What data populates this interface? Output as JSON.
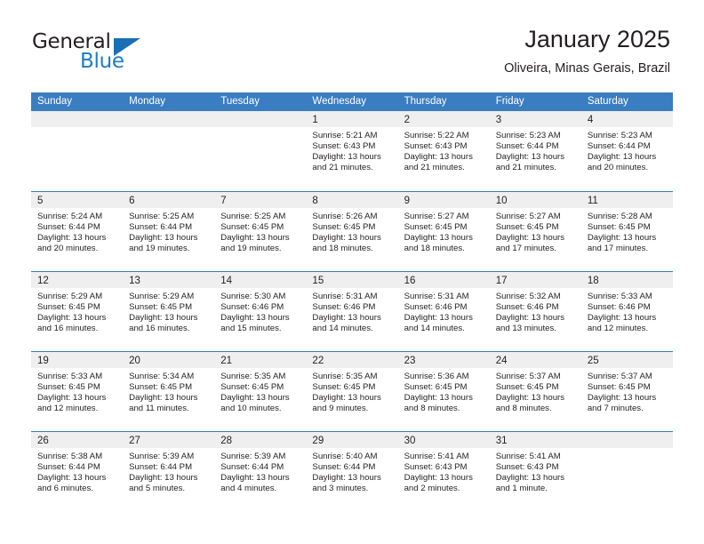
{
  "brand": {
    "name_top": "General",
    "name_bottom": "Blue",
    "accent_color": "#1a6fb5"
  },
  "header": {
    "title": "January 2025",
    "subtitle": "Oliveira, Minas Gerais, Brazil"
  },
  "calendar": {
    "header_bg": "#3a7dc0",
    "daynum_bg": "#efefef",
    "weekday_names": [
      "Sunday",
      "Monday",
      "Tuesday",
      "Wednesday",
      "Thursday",
      "Friday",
      "Saturday"
    ],
    "weeks": [
      [
        {
          "day": "",
          "lines": []
        },
        {
          "day": "",
          "lines": []
        },
        {
          "day": "",
          "lines": []
        },
        {
          "day": "1",
          "lines": [
            "Sunrise: 5:21 AM",
            "Sunset: 6:43 PM",
            "Daylight: 13 hours",
            "and 21 minutes."
          ]
        },
        {
          "day": "2",
          "lines": [
            "Sunrise: 5:22 AM",
            "Sunset: 6:43 PM",
            "Daylight: 13 hours",
            "and 21 minutes."
          ]
        },
        {
          "day": "3",
          "lines": [
            "Sunrise: 5:23 AM",
            "Sunset: 6:44 PM",
            "Daylight: 13 hours",
            "and 21 minutes."
          ]
        },
        {
          "day": "4",
          "lines": [
            "Sunrise: 5:23 AM",
            "Sunset: 6:44 PM",
            "Daylight: 13 hours",
            "and 20 minutes."
          ]
        }
      ],
      [
        {
          "day": "5",
          "lines": [
            "Sunrise: 5:24 AM",
            "Sunset: 6:44 PM",
            "Daylight: 13 hours",
            "and 20 minutes."
          ]
        },
        {
          "day": "6",
          "lines": [
            "Sunrise: 5:25 AM",
            "Sunset: 6:44 PM",
            "Daylight: 13 hours",
            "and 19 minutes."
          ]
        },
        {
          "day": "7",
          "lines": [
            "Sunrise: 5:25 AM",
            "Sunset: 6:45 PM",
            "Daylight: 13 hours",
            "and 19 minutes."
          ]
        },
        {
          "day": "8",
          "lines": [
            "Sunrise: 5:26 AM",
            "Sunset: 6:45 PM",
            "Daylight: 13 hours",
            "and 18 minutes."
          ]
        },
        {
          "day": "9",
          "lines": [
            "Sunrise: 5:27 AM",
            "Sunset: 6:45 PM",
            "Daylight: 13 hours",
            "and 18 minutes."
          ]
        },
        {
          "day": "10",
          "lines": [
            "Sunrise: 5:27 AM",
            "Sunset: 6:45 PM",
            "Daylight: 13 hours",
            "and 17 minutes."
          ]
        },
        {
          "day": "11",
          "lines": [
            "Sunrise: 5:28 AM",
            "Sunset: 6:45 PM",
            "Daylight: 13 hours",
            "and 17 minutes."
          ]
        }
      ],
      [
        {
          "day": "12",
          "lines": [
            "Sunrise: 5:29 AM",
            "Sunset: 6:45 PM",
            "Daylight: 13 hours",
            "and 16 minutes."
          ]
        },
        {
          "day": "13",
          "lines": [
            "Sunrise: 5:29 AM",
            "Sunset: 6:45 PM",
            "Daylight: 13 hours",
            "and 16 minutes."
          ]
        },
        {
          "day": "14",
          "lines": [
            "Sunrise: 5:30 AM",
            "Sunset: 6:46 PM",
            "Daylight: 13 hours",
            "and 15 minutes."
          ]
        },
        {
          "day": "15",
          "lines": [
            "Sunrise: 5:31 AM",
            "Sunset: 6:46 PM",
            "Daylight: 13 hours",
            "and 14 minutes."
          ]
        },
        {
          "day": "16",
          "lines": [
            "Sunrise: 5:31 AM",
            "Sunset: 6:46 PM",
            "Daylight: 13 hours",
            "and 14 minutes."
          ]
        },
        {
          "day": "17",
          "lines": [
            "Sunrise: 5:32 AM",
            "Sunset: 6:46 PM",
            "Daylight: 13 hours",
            "and 13 minutes."
          ]
        },
        {
          "day": "18",
          "lines": [
            "Sunrise: 5:33 AM",
            "Sunset: 6:46 PM",
            "Daylight: 13 hours",
            "and 12 minutes."
          ]
        }
      ],
      [
        {
          "day": "19",
          "lines": [
            "Sunrise: 5:33 AM",
            "Sunset: 6:45 PM",
            "Daylight: 13 hours",
            "and 12 minutes."
          ]
        },
        {
          "day": "20",
          "lines": [
            "Sunrise: 5:34 AM",
            "Sunset: 6:45 PM",
            "Daylight: 13 hours",
            "and 11 minutes."
          ]
        },
        {
          "day": "21",
          "lines": [
            "Sunrise: 5:35 AM",
            "Sunset: 6:45 PM",
            "Daylight: 13 hours",
            "and 10 minutes."
          ]
        },
        {
          "day": "22",
          "lines": [
            "Sunrise: 5:35 AM",
            "Sunset: 6:45 PM",
            "Daylight: 13 hours",
            "and 9 minutes."
          ]
        },
        {
          "day": "23",
          "lines": [
            "Sunrise: 5:36 AM",
            "Sunset: 6:45 PM",
            "Daylight: 13 hours",
            "and 8 minutes."
          ]
        },
        {
          "day": "24",
          "lines": [
            "Sunrise: 5:37 AM",
            "Sunset: 6:45 PM",
            "Daylight: 13 hours",
            "and 8 minutes."
          ]
        },
        {
          "day": "25",
          "lines": [
            "Sunrise: 5:37 AM",
            "Sunset: 6:45 PM",
            "Daylight: 13 hours",
            "and 7 minutes."
          ]
        }
      ],
      [
        {
          "day": "26",
          "lines": [
            "Sunrise: 5:38 AM",
            "Sunset: 6:44 PM",
            "Daylight: 13 hours",
            "and 6 minutes."
          ]
        },
        {
          "day": "27",
          "lines": [
            "Sunrise: 5:39 AM",
            "Sunset: 6:44 PM",
            "Daylight: 13 hours",
            "and 5 minutes."
          ]
        },
        {
          "day": "28",
          "lines": [
            "Sunrise: 5:39 AM",
            "Sunset: 6:44 PM",
            "Daylight: 13 hours",
            "and 4 minutes."
          ]
        },
        {
          "day": "29",
          "lines": [
            "Sunrise: 5:40 AM",
            "Sunset: 6:44 PM",
            "Daylight: 13 hours",
            "and 3 minutes."
          ]
        },
        {
          "day": "30",
          "lines": [
            "Sunrise: 5:41 AM",
            "Sunset: 6:43 PM",
            "Daylight: 13 hours",
            "and 2 minutes."
          ]
        },
        {
          "day": "31",
          "lines": [
            "Sunrise: 5:41 AM",
            "Sunset: 6:43 PM",
            "Daylight: 13 hours",
            "and 1 minute."
          ]
        },
        {
          "day": "",
          "lines": []
        }
      ]
    ]
  }
}
